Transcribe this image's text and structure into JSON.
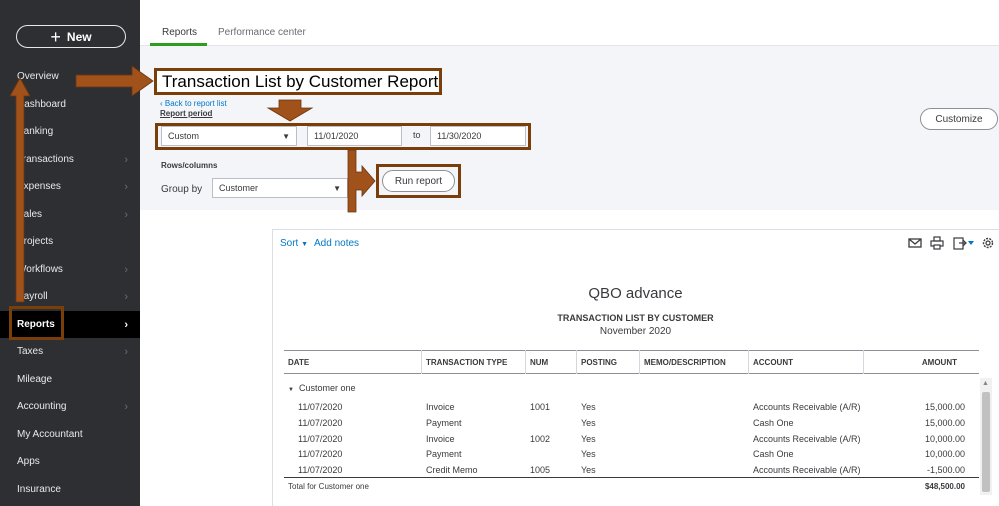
{
  "sidebar": {
    "new_label": "New",
    "items": [
      {
        "label": "Overview",
        "chevron": false
      },
      {
        "label": "Dashboard",
        "chevron": false
      },
      {
        "label": "Banking",
        "chevron": false
      },
      {
        "label": "Transactions",
        "chevron": true
      },
      {
        "label": "Expenses",
        "chevron": true
      },
      {
        "label": "Sales",
        "chevron": true
      },
      {
        "label": "Projects",
        "chevron": false
      },
      {
        "label": "Workflows",
        "chevron": true
      },
      {
        "label": "Payroll",
        "chevron": true
      },
      {
        "label": "Reports",
        "chevron": true,
        "active": true
      },
      {
        "label": "Taxes",
        "chevron": true
      },
      {
        "label": "Mileage",
        "chevron": false
      },
      {
        "label": "Accounting",
        "chevron": true
      },
      {
        "label": "My Accountant",
        "chevron": false
      },
      {
        "label": "Apps",
        "chevron": false
      },
      {
        "label": "Insurance",
        "chevron": false
      }
    ]
  },
  "tabs": [
    {
      "label": "Reports",
      "active": true
    },
    {
      "label": "Performance center",
      "active": false
    }
  ],
  "header": {
    "title": "Transaction List by Customer Report",
    "back_link": "Back to report list",
    "report_period_label": "Report period",
    "period_select": "Custom",
    "start_date": "11/01/2020",
    "to_label": "to",
    "end_date": "11/30/2020",
    "rows_columns_label": "Rows/columns",
    "group_by_label": "Group by",
    "group_by_value": "Customer",
    "run_report_label": "Run report",
    "customize_label": "Customize"
  },
  "toolbar": {
    "sort_label": "Sort",
    "add_notes_label": "Add notes"
  },
  "report": {
    "company": "QBO advance",
    "title": "TRANSACTION LIST BY CUSTOMER",
    "date_range": "November 2020",
    "columns": [
      "DATE",
      "TRANSACTION TYPE",
      "NUM",
      "POSTING",
      "MEMO/DESCRIPTION",
      "ACCOUNT",
      "AMOUNT"
    ],
    "group_name": "Customer one",
    "rows": [
      {
        "date": "11/07/2020",
        "type": "Invoice",
        "num": "1001",
        "posting": "Yes",
        "memo": "",
        "account": "Accounts Receivable (A/R)",
        "amount": "15,000.00"
      },
      {
        "date": "11/07/2020",
        "type": "Payment",
        "num": "",
        "posting": "Yes",
        "memo": "",
        "account": "Cash One",
        "amount": "15,000.00"
      },
      {
        "date": "11/07/2020",
        "type": "Invoice",
        "num": "1002",
        "posting": "Yes",
        "memo": "",
        "account": "Accounts Receivable (A/R)",
        "amount": "10,000.00"
      },
      {
        "date": "11/07/2020",
        "type": "Payment",
        "num": "",
        "posting": "Yes",
        "memo": "",
        "account": "Cash One",
        "amount": "10,000.00"
      },
      {
        "date": "11/07/2020",
        "type": "Credit Memo",
        "num": "1005",
        "posting": "Yes",
        "memo": "",
        "account": "Accounts Receivable (A/R)",
        "amount": "-1,500.00"
      }
    ],
    "total_label": "Total for Customer one",
    "total_amount": "$48,500.00"
  },
  "colors": {
    "sidebar_bg": "#2d2f33",
    "accent_green": "#2ca01c",
    "link_blue": "#0077c5",
    "annotation_brown": "#7a3e0a",
    "arrow_orange": "#a0521a"
  }
}
